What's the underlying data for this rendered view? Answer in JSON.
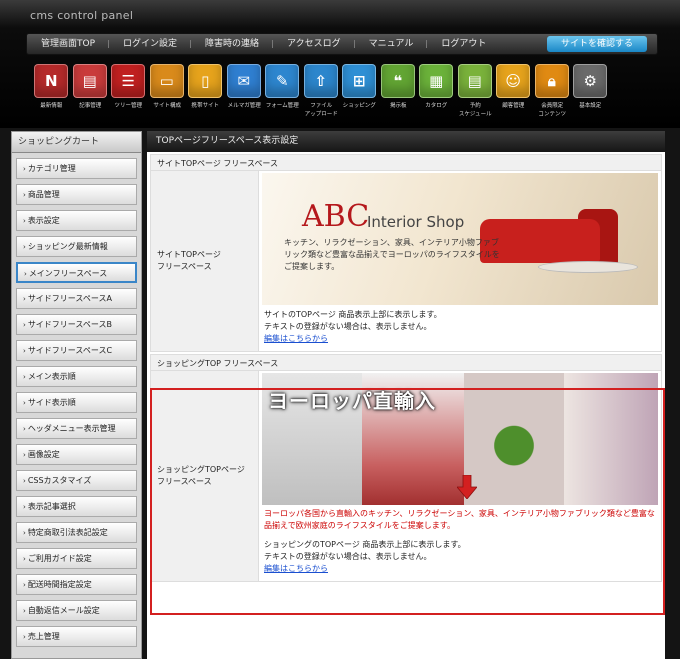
{
  "app": {
    "title": "cms control panel"
  },
  "nav": {
    "items": [
      "管理画面TOP",
      "ログイン設定",
      "障害時の連絡",
      "アクセスログ",
      "マニュアル",
      "ログアウト"
    ],
    "cta": "サイトを確認する"
  },
  "toolbar": {
    "items": [
      {
        "label": "最新情報",
        "icon": "news-icon",
        "color": "#b52a2a"
      },
      {
        "label": "記事管理",
        "icon": "article-icon",
        "color": "#c93b3b"
      },
      {
        "label": "ツリー管理",
        "icon": "tree-icon",
        "color": "#c02020"
      },
      {
        "label": "サイト構成",
        "icon": "monitor-icon",
        "color": "#d98a1b"
      },
      {
        "label": "携帯サイト",
        "icon": "mobile-icon",
        "color": "#e6a31c"
      },
      {
        "label": "メルマガ管理",
        "icon": "mail-icon",
        "color": "#2f7fd1"
      },
      {
        "label": "フォーム管理",
        "icon": "form-icon",
        "color": "#2d86cf"
      },
      {
        "label": "ファイル\nアップロード",
        "icon": "upload-icon",
        "color": "#2c86cc"
      },
      {
        "label": "ショッピング",
        "icon": "cart-icon",
        "color": "#2e8fd4"
      },
      {
        "label": "掲示板",
        "icon": "board-icon",
        "color": "#62a533"
      },
      {
        "label": "カタログ",
        "icon": "catalog-icon",
        "color": "#6bb23a"
      },
      {
        "label": "予約\nスケジュール",
        "icon": "schedule-icon",
        "color": "#7ab23b"
      },
      {
        "label": "顧客管理",
        "icon": "customer-icon",
        "color": "#e6a31c"
      },
      {
        "label": "会員限定\nコンテンツ",
        "icon": "lock-icon",
        "color": "#e08a13"
      },
      {
        "label": "基本設定",
        "icon": "gear-icon",
        "color": "#6a6a6a"
      }
    ]
  },
  "sidebar": {
    "heading": "ショッピングカート",
    "items": [
      "カテゴリ管理",
      "商品管理",
      "表示設定",
      "ショッピング最新情報",
      "メインフリースペース",
      "サイドフリースペースA",
      "サイドフリースペースB",
      "サイドフリースペースC",
      "メイン表示順",
      "サイド表示順",
      "ヘッダメニュー表示管理",
      "画像設定",
      "CSSカスタマイズ",
      "表示記事選択",
      "特定商取引法表記設定",
      "ご利用ガイド設定",
      "配送時間指定設定",
      "自動返信メール設定",
      "売上管理"
    ],
    "active_index": 4
  },
  "main": {
    "heading": "TOPページフリースペース表示設定",
    "site_section": {
      "title": "サイトTOPページ フリースペース",
      "label": "サイトTOPページ\nフリースペース",
      "banner": {
        "logo_abc": "ABC",
        "logo_shop": "Interior Shop",
        "copy": "キッチン、リラクゼーション、家具、インテリア小物ファブリック類など豊富な品揃えでヨーロッパのライフスタイルをご提案します。"
      },
      "note_line1": "サイトのTOPページ 商品表示上部に表示します。",
      "note_line2": "テキストの登録がない場合は、表示しません。",
      "link": "編集はこちらから"
    },
    "shopping_section": {
      "title": "ショッピングTOP フリースペース",
      "label": "ショッピングTOPページ\nフリースペース",
      "banner": {
        "title": "ヨーロッパ直輸入"
      },
      "copy": "ヨーロッパ各国から直輸入のキッチン、リラクゼーション、家具、インテリア小物ファブリック類など豊富な品揃えで欧州家庭のライフスタイルをご提案します。",
      "note_line1": "ショッピングのTOPページ 商品表示上部に表示します。",
      "note_line2": "テキストの登録がない場合は、表示しません。",
      "link": "編集はこちらから"
    }
  },
  "colors": {
    "highlight": "#d32020",
    "accent": "#1a87c6",
    "arrow": "#d32020"
  }
}
